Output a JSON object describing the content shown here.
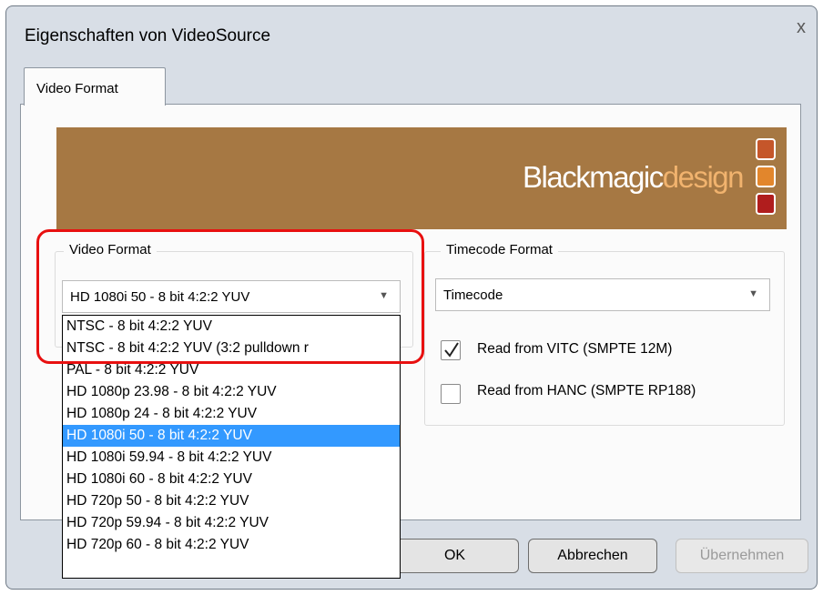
{
  "window": {
    "title": "Eigenschaften von VideoSource",
    "close_glyph": "x"
  },
  "tabs": [
    {
      "label": "Video Format",
      "active": true
    }
  ],
  "banner": {
    "brand_word": "Blackmagic",
    "brand_suffix": "design"
  },
  "video_format": {
    "group_label": "Video Format",
    "selected": "HD 1080i 50 - 8 bit 4:2:2 YUV",
    "options": [
      "NTSC - 8 bit 4:2:2 YUV",
      "NTSC - 8 bit 4:2:2 YUV (3:2 pulldown r",
      "PAL - 8 bit 4:2:2 YUV",
      "HD 1080p 23.98 - 8 bit 4:2:2 YUV",
      "HD 1080p 24 - 8 bit 4:2:2 YUV",
      "HD 1080i 50 - 8 bit 4:2:2 YUV",
      "HD 1080i 59.94 - 8 bit 4:2:2 YUV",
      "HD 1080i 60 - 8 bit 4:2:2 YUV",
      "HD 720p 50 - 8 bit 4:2:2 YUV",
      "HD 720p 59.94 - 8 bit 4:2:2 YUV",
      "HD 720p 60 - 8 bit 4:2:2 YUV"
    ],
    "highlighted_index": 5
  },
  "timecode_format": {
    "group_label": "Timecode Format",
    "selected": "Timecode",
    "checkboxes": [
      {
        "label": "Read from VITC (SMPTE 12M)",
        "checked": true
      },
      {
        "label": "Read from HANC (SMPTE RP188)",
        "checked": false
      }
    ]
  },
  "buttons": {
    "ok": "OK",
    "cancel": "Abbrechen",
    "apply": "Übernehmen"
  },
  "colors": {
    "banner": "#a67843",
    "highlight": "#3399ff",
    "annotation": "#e81010"
  },
  "icons": {
    "dropdown_arrow": "chevron-down-icon",
    "check": "checkmark-icon",
    "close": "close-icon"
  }
}
